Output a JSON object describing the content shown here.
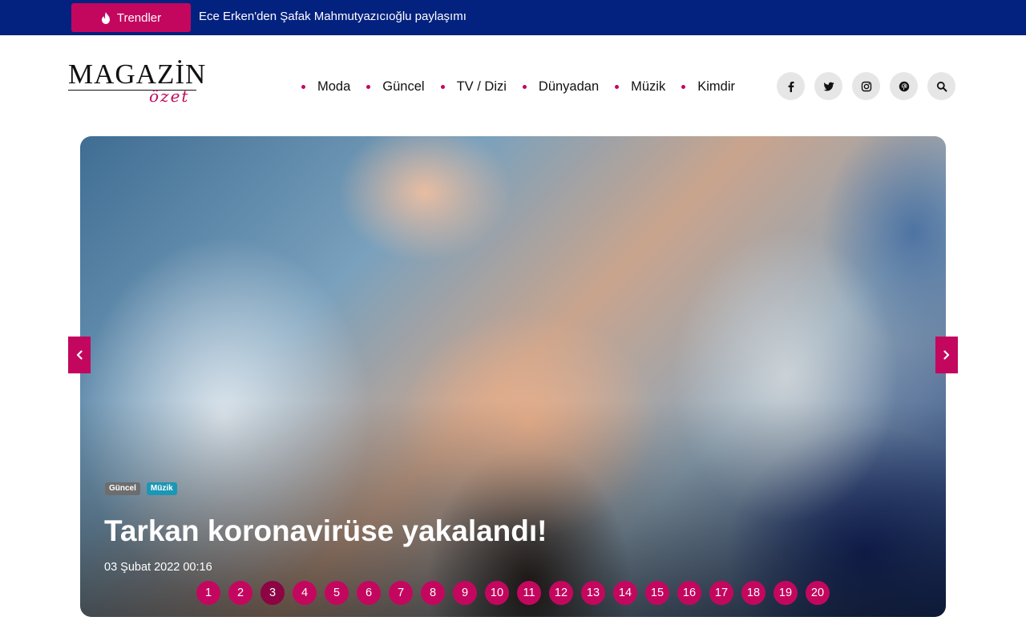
{
  "topbar": {
    "trend_label": "Trendler",
    "headline": "Ece Erken'den Şafak Mahmutyazıcıoğlu paylaşımı",
    "colors": {
      "background": "#03217f",
      "accent": "#c3075f"
    }
  },
  "logo": {
    "main": "MAGAZİN",
    "sub": "özet"
  },
  "nav": {
    "items": [
      {
        "label": "Moda"
      },
      {
        "label": "Güncel"
      },
      {
        "label": "TV / Dizi"
      },
      {
        "label": "Dünyadan"
      },
      {
        "label": "Müzik"
      },
      {
        "label": "Kimdir"
      }
    ]
  },
  "social": {
    "icons": [
      "facebook-icon",
      "twitter-icon",
      "instagram-icon",
      "pinterest-icon",
      "search-icon"
    ]
  },
  "hero": {
    "tags": [
      "Güncel",
      "Müzik"
    ],
    "title": "Tarkan koronavirüse yakalandı!",
    "date": "03 Şubat 2022 00:16",
    "pages": [
      "1",
      "2",
      "3",
      "4",
      "5",
      "6",
      "7",
      "8",
      "9",
      "10",
      "11",
      "12",
      "13",
      "14",
      "15",
      "16",
      "17",
      "18",
      "19",
      "20"
    ],
    "active_page": "3",
    "arrows": {
      "prev": "chevron-left-icon",
      "next": "chevron-right-icon"
    }
  }
}
